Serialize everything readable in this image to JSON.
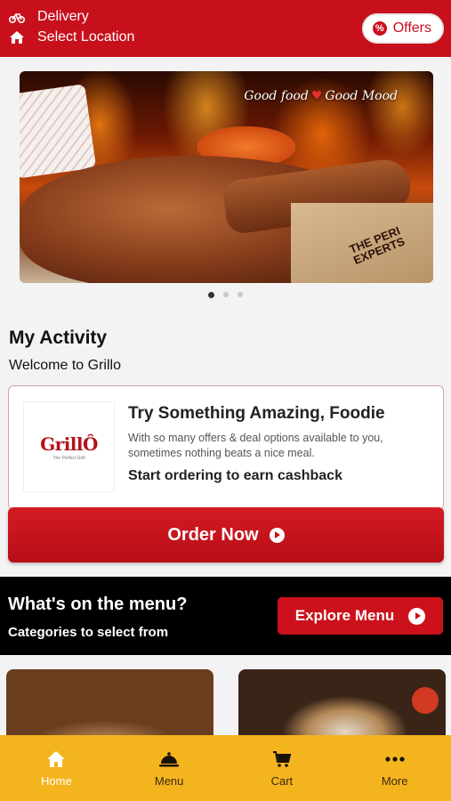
{
  "header": {
    "delivery_label": "Delivery",
    "location_label": "Select Location",
    "offers_label": "Offers",
    "bg_color": "#c8101c"
  },
  "banner": {
    "tagline_left": "Good food",
    "tagline_right": "Good Mood",
    "brand_mark": "THE PERI EXPERTS",
    "carousel_total": 3,
    "carousel_active": 1
  },
  "activity": {
    "title": "My Activity",
    "subtitle": "Welcome to Grillo",
    "card": {
      "logo_text": "GrillÔ",
      "logo_subtext": "The Perfect Grill",
      "title": "Try Something Amazing, Foodie",
      "description": "With so many offers & deal options available to you, sometimes nothing beats a nice meal.",
      "cta_text": "Start ordering to earn cashback"
    },
    "order_button": "Order Now"
  },
  "menu_section": {
    "title": "What's on the menu?",
    "subtitle": "Categories to select from",
    "explore_button": "Explore Menu"
  },
  "bottom_nav": [
    {
      "label": "Home",
      "icon": "home-icon",
      "active": true
    },
    {
      "label": "Menu",
      "icon": "cloche-icon",
      "active": false
    },
    {
      "label": "Cart",
      "icon": "cart-icon",
      "active": false
    },
    {
      "label": "More",
      "icon": "more-dots-icon",
      "active": false
    }
  ],
  "colors": {
    "brand_red": "#c8101c",
    "nav_yellow": "#f4b41e"
  }
}
